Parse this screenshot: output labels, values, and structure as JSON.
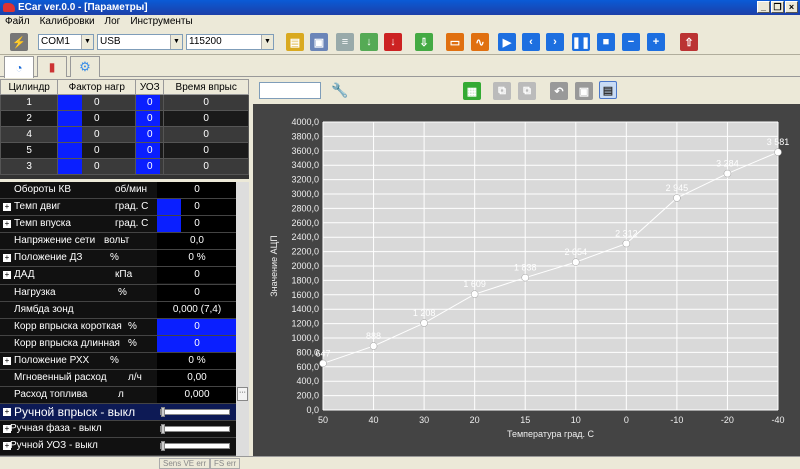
{
  "window": {
    "title": "ECar ver.0.0 - [Параметры]"
  },
  "menu": [
    "Файл",
    "Калибровки",
    "Лог",
    "Инструменты"
  ],
  "toolbar": {
    "port": "COM1",
    "interface": "USB",
    "baud": "115200"
  },
  "cylinders": {
    "headers": [
      "Цилиндр",
      "Фактор нагр",
      "УОЗ",
      "Время впрыс"
    ],
    "rows": [
      [
        "1",
        "0",
        "0",
        "0"
      ],
      [
        "2",
        "0",
        "0",
        "0"
      ],
      [
        "4",
        "0",
        "0",
        "0"
      ],
      [
        "5",
        "0",
        "0",
        "0"
      ],
      [
        "3",
        "0",
        "0",
        "0"
      ]
    ]
  },
  "params": [
    {
      "name": "Обороты КВ",
      "unit": "об/мин",
      "value": "0",
      "expand": false,
      "bar": 0
    },
    {
      "name": "Темп двиг",
      "unit": "град. С",
      "value": "0",
      "expand": true,
      "bar": 0.3
    },
    {
      "name": "Темп впуска",
      "unit": "град. С",
      "value": "0",
      "expand": true,
      "bar": 0.3
    },
    {
      "name": "Напряжение сети",
      "unit": "вольт",
      "value": "0,0",
      "expand": false,
      "bar": 0
    },
    {
      "name": "Положение ДЗ",
      "unit": "%",
      "value": "0 %",
      "expand": true,
      "bar": 0
    },
    {
      "name": "ДАД",
      "unit": "кПа",
      "value": "0",
      "expand": true,
      "bar": 0
    },
    {
      "name": "Нагрузка",
      "unit": "%",
      "value": "0",
      "expand": false,
      "bar": 0
    },
    {
      "name": "Лямбда зонд",
      "unit": "",
      "value": "0,000 (7,4)",
      "expand": false,
      "bar": 0
    },
    {
      "name": "Корр впрыска короткая",
      "unit": "%",
      "value": "0",
      "expand": false,
      "bar": 1
    },
    {
      "name": "Корр впрыска длинная",
      "unit": "%",
      "value": "0",
      "expand": false,
      "bar": 1
    },
    {
      "name": "Положение РХХ",
      "unit": "%",
      "value": "0 %",
      "expand": true,
      "bar": 0
    },
    {
      "name": "Мгновенный расход",
      "unit": "л/ч",
      "value": "0,00",
      "expand": false,
      "bar": 0
    },
    {
      "name": "Расход топлива",
      "unit": "л",
      "value": "0,000",
      "expand": false,
      "bar": 0
    }
  ],
  "manual": [
    {
      "label": "Ручной впрыск - выкл",
      "big": true,
      "level": 0
    },
    {
      "label": "Ручная фаза - выкл",
      "big": false,
      "level": 0
    },
    {
      "label": "Ручной УОЗ - выкл",
      "big": false,
      "level": 0
    }
  ],
  "chart_data": {
    "type": "line",
    "xlabel": "Температура град. С",
    "ylabel": "Значение АЦП",
    "categories": [
      "50",
      "40",
      "30",
      "20",
      "15",
      "10",
      "0",
      "-10",
      "-20",
      "-40"
    ],
    "values": [
      647,
      888,
      1208,
      1609,
      1838,
      2054,
      2312,
      2945,
      3284,
      3581
    ],
    "value_labels": [
      "647",
      "888",
      "1 208",
      "1 609",
      "1 838",
      "2 054",
      "2 312",
      "2 945",
      "3 284",
      "3 581"
    ],
    "ylim": [
      0,
      4000
    ],
    "ytick_labels": [
      "0,0",
      "200,0",
      "400,0",
      "600,0",
      "800,0",
      "1000,0",
      "1200,0",
      "1400,0",
      "1600,0",
      "1800,0",
      "2000,0",
      "2200,0",
      "2400,0",
      "2600,0",
      "2800,0",
      "3000,0",
      "3200,0",
      "3400,0",
      "3600,0",
      "3800,0",
      "4000,0"
    ],
    "grid": true
  },
  "status": [
    "Sens VE err",
    "FS err"
  ]
}
